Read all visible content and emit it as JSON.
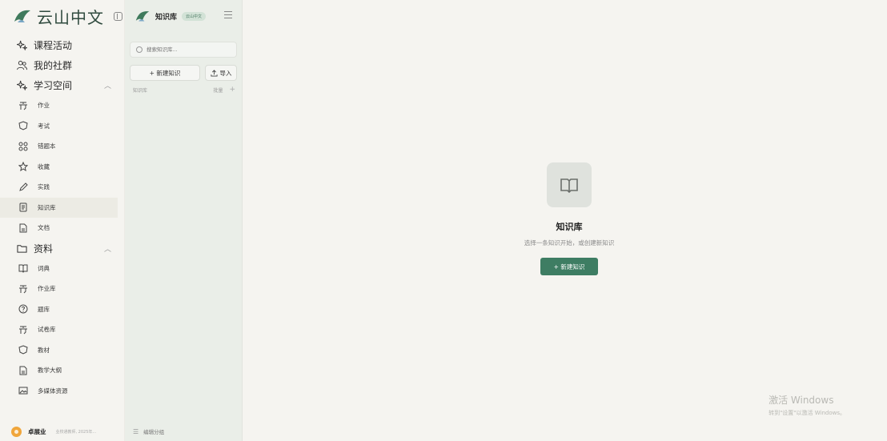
{
  "brand": {
    "name": "云山中文"
  },
  "nav": {
    "main_items": [
      {
        "label": "课程活动",
        "icon": "sparkle-icon"
      },
      {
        "label": "我的社群",
        "icon": "people-icon"
      }
    ],
    "study_space": {
      "label": "学习空间",
      "icon": "sparkle-icon",
      "expanded": true,
      "items": [
        {
          "label": "作业",
          "icon": "assignment-icon"
        },
        {
          "label": "考试",
          "icon": "shield-icon"
        },
        {
          "label": "错题本",
          "icon": "grid-icon"
        },
        {
          "label": "收藏",
          "icon": "star-icon"
        },
        {
          "label": "实践",
          "icon": "pencil-icon"
        },
        {
          "label": "知识库",
          "icon": "note-icon",
          "active": true
        },
        {
          "label": "文档",
          "icon": "document-icon"
        }
      ]
    },
    "materials": {
      "label": "资料",
      "icon": "folder-icon",
      "expanded": true,
      "items": [
        {
          "label": "词典",
          "icon": "book-icon"
        },
        {
          "label": "作业库",
          "icon": "assignment-icon"
        },
        {
          "label": "题库",
          "icon": "question-icon"
        },
        {
          "label": "试卷库",
          "icon": "assignment-icon"
        },
        {
          "label": "教材",
          "icon": "shield-icon"
        },
        {
          "label": "教学大纲",
          "icon": "document-icon"
        },
        {
          "label": "多媒体资源",
          "icon": "image-icon"
        }
      ]
    }
  },
  "user": {
    "name": "卓展业",
    "org": "业校通教师, 2025年..."
  },
  "knowledge_panel": {
    "title": "知识库",
    "badge": "云山中文",
    "search_placeholder": "搜索知识库...",
    "new_button": "+ 新建知识",
    "import_button": "导入",
    "list_header": "知识库",
    "batch_label": "批量",
    "add_symbol": "+",
    "footer_label": "编辑分组"
  },
  "main": {
    "empty_title": "知识库",
    "empty_desc": "选择一条知识开始，或创建新知识",
    "empty_button": "+ 新建知识"
  },
  "watermark": {
    "line1": "激活 Windows",
    "line2": "转到\"设置\"以激活 Windows。"
  },
  "colors": {
    "accent": "#3e7d63",
    "sidebar_bg": "#f5f4f0",
    "panel_bg": "#eaeee8"
  }
}
